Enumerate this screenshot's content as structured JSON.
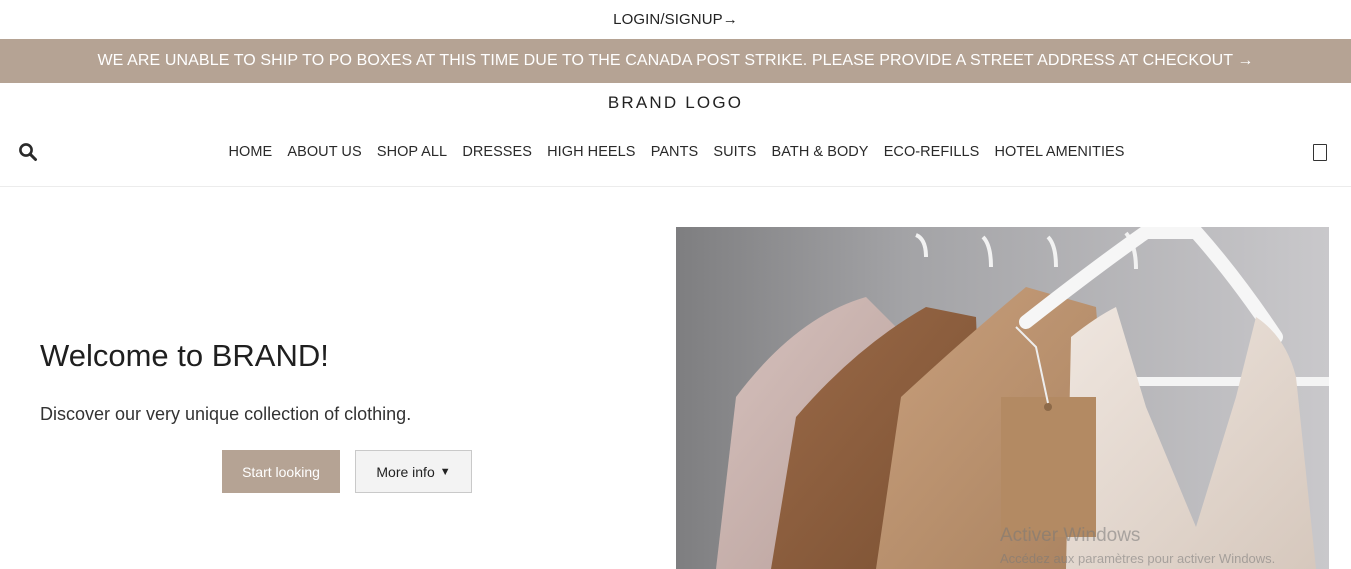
{
  "header": {
    "login_link": "LOGIN/SIGNUP→",
    "announcement": "WE ARE UNABLE TO SHIP TO PO BOXES AT THIS TIME DUE TO THE CANADA POST STRIKE. PLEASE PROVIDE A STREET ADDRESS AT CHECKOUT →",
    "brand_logo": "BRAND LOGO"
  },
  "nav": {
    "items": [
      "HOME",
      "ABOUT US",
      "SHOP ALL",
      "DRESSES",
      "HIGH HEELS",
      "PANTS",
      "SUITS",
      "BATH & BODY",
      "ECO-REFILLS",
      "HOTEL AMENITIES"
    ],
    "search_icon": "search-icon",
    "cart_icon": "cart-icon"
  },
  "hero": {
    "title": "Welcome to BRAND!",
    "subtitle": "Discover our very unique collection of clothing.",
    "primary_button": "Start looking",
    "secondary_button": "More info",
    "secondary_button_caret": "▼",
    "image_alt": "Clothes on white hangers"
  },
  "watermark": {
    "line1": "Activer Windows",
    "line2": "Accédez aux paramètres pour activer Windows."
  },
  "colors": {
    "accent": "#b5a394",
    "text": "#222222",
    "background": "#ffffff"
  }
}
